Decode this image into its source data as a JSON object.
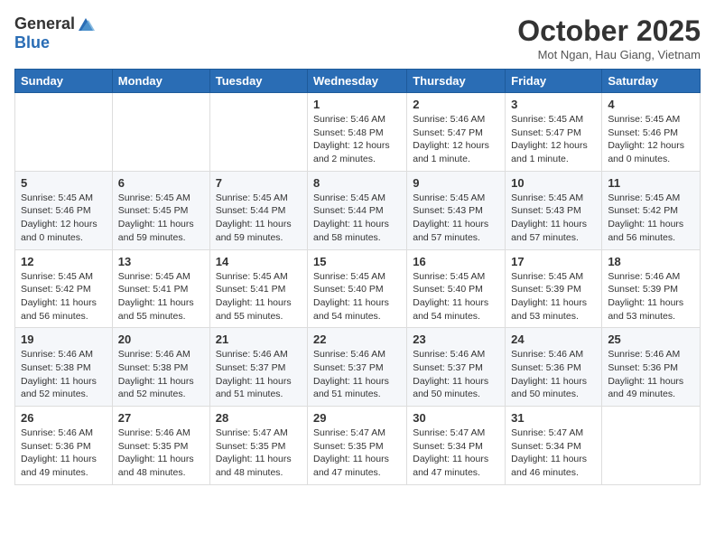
{
  "header": {
    "logo_general": "General",
    "logo_blue": "Blue",
    "month_year": "October 2025",
    "location": "Mot Ngan, Hau Giang, Vietnam"
  },
  "days_of_week": [
    "Sunday",
    "Monday",
    "Tuesday",
    "Wednesday",
    "Thursday",
    "Friday",
    "Saturday"
  ],
  "weeks": [
    [
      {
        "day": "",
        "info": ""
      },
      {
        "day": "",
        "info": ""
      },
      {
        "day": "",
        "info": ""
      },
      {
        "day": "1",
        "info": "Sunrise: 5:46 AM\nSunset: 5:48 PM\nDaylight: 12 hours and 2 minutes."
      },
      {
        "day": "2",
        "info": "Sunrise: 5:46 AM\nSunset: 5:47 PM\nDaylight: 12 hours and 1 minute."
      },
      {
        "day": "3",
        "info": "Sunrise: 5:45 AM\nSunset: 5:47 PM\nDaylight: 12 hours and 1 minute."
      },
      {
        "day": "4",
        "info": "Sunrise: 5:45 AM\nSunset: 5:46 PM\nDaylight: 12 hours and 0 minutes."
      }
    ],
    [
      {
        "day": "5",
        "info": "Sunrise: 5:45 AM\nSunset: 5:46 PM\nDaylight: 12 hours and 0 minutes."
      },
      {
        "day": "6",
        "info": "Sunrise: 5:45 AM\nSunset: 5:45 PM\nDaylight: 11 hours and 59 minutes."
      },
      {
        "day": "7",
        "info": "Sunrise: 5:45 AM\nSunset: 5:44 PM\nDaylight: 11 hours and 59 minutes."
      },
      {
        "day": "8",
        "info": "Sunrise: 5:45 AM\nSunset: 5:44 PM\nDaylight: 11 hours and 58 minutes."
      },
      {
        "day": "9",
        "info": "Sunrise: 5:45 AM\nSunset: 5:43 PM\nDaylight: 11 hours and 57 minutes."
      },
      {
        "day": "10",
        "info": "Sunrise: 5:45 AM\nSunset: 5:43 PM\nDaylight: 11 hours and 57 minutes."
      },
      {
        "day": "11",
        "info": "Sunrise: 5:45 AM\nSunset: 5:42 PM\nDaylight: 11 hours and 56 minutes."
      }
    ],
    [
      {
        "day": "12",
        "info": "Sunrise: 5:45 AM\nSunset: 5:42 PM\nDaylight: 11 hours and 56 minutes."
      },
      {
        "day": "13",
        "info": "Sunrise: 5:45 AM\nSunset: 5:41 PM\nDaylight: 11 hours and 55 minutes."
      },
      {
        "day": "14",
        "info": "Sunrise: 5:45 AM\nSunset: 5:41 PM\nDaylight: 11 hours and 55 minutes."
      },
      {
        "day": "15",
        "info": "Sunrise: 5:45 AM\nSunset: 5:40 PM\nDaylight: 11 hours and 54 minutes."
      },
      {
        "day": "16",
        "info": "Sunrise: 5:45 AM\nSunset: 5:40 PM\nDaylight: 11 hours and 54 minutes."
      },
      {
        "day": "17",
        "info": "Sunrise: 5:45 AM\nSunset: 5:39 PM\nDaylight: 11 hours and 53 minutes."
      },
      {
        "day": "18",
        "info": "Sunrise: 5:46 AM\nSunset: 5:39 PM\nDaylight: 11 hours and 53 minutes."
      }
    ],
    [
      {
        "day": "19",
        "info": "Sunrise: 5:46 AM\nSunset: 5:38 PM\nDaylight: 11 hours and 52 minutes."
      },
      {
        "day": "20",
        "info": "Sunrise: 5:46 AM\nSunset: 5:38 PM\nDaylight: 11 hours and 52 minutes."
      },
      {
        "day": "21",
        "info": "Sunrise: 5:46 AM\nSunset: 5:37 PM\nDaylight: 11 hours and 51 minutes."
      },
      {
        "day": "22",
        "info": "Sunrise: 5:46 AM\nSunset: 5:37 PM\nDaylight: 11 hours and 51 minutes."
      },
      {
        "day": "23",
        "info": "Sunrise: 5:46 AM\nSunset: 5:37 PM\nDaylight: 11 hours and 50 minutes."
      },
      {
        "day": "24",
        "info": "Sunrise: 5:46 AM\nSunset: 5:36 PM\nDaylight: 11 hours and 50 minutes."
      },
      {
        "day": "25",
        "info": "Sunrise: 5:46 AM\nSunset: 5:36 PM\nDaylight: 11 hours and 49 minutes."
      }
    ],
    [
      {
        "day": "26",
        "info": "Sunrise: 5:46 AM\nSunset: 5:36 PM\nDaylight: 11 hours and 49 minutes."
      },
      {
        "day": "27",
        "info": "Sunrise: 5:46 AM\nSunset: 5:35 PM\nDaylight: 11 hours and 48 minutes."
      },
      {
        "day": "28",
        "info": "Sunrise: 5:47 AM\nSunset: 5:35 PM\nDaylight: 11 hours and 48 minutes."
      },
      {
        "day": "29",
        "info": "Sunrise: 5:47 AM\nSunset: 5:35 PM\nDaylight: 11 hours and 47 minutes."
      },
      {
        "day": "30",
        "info": "Sunrise: 5:47 AM\nSunset: 5:34 PM\nDaylight: 11 hours and 47 minutes."
      },
      {
        "day": "31",
        "info": "Sunrise: 5:47 AM\nSunset: 5:34 PM\nDaylight: 11 hours and 46 minutes."
      },
      {
        "day": "",
        "info": ""
      }
    ]
  ]
}
